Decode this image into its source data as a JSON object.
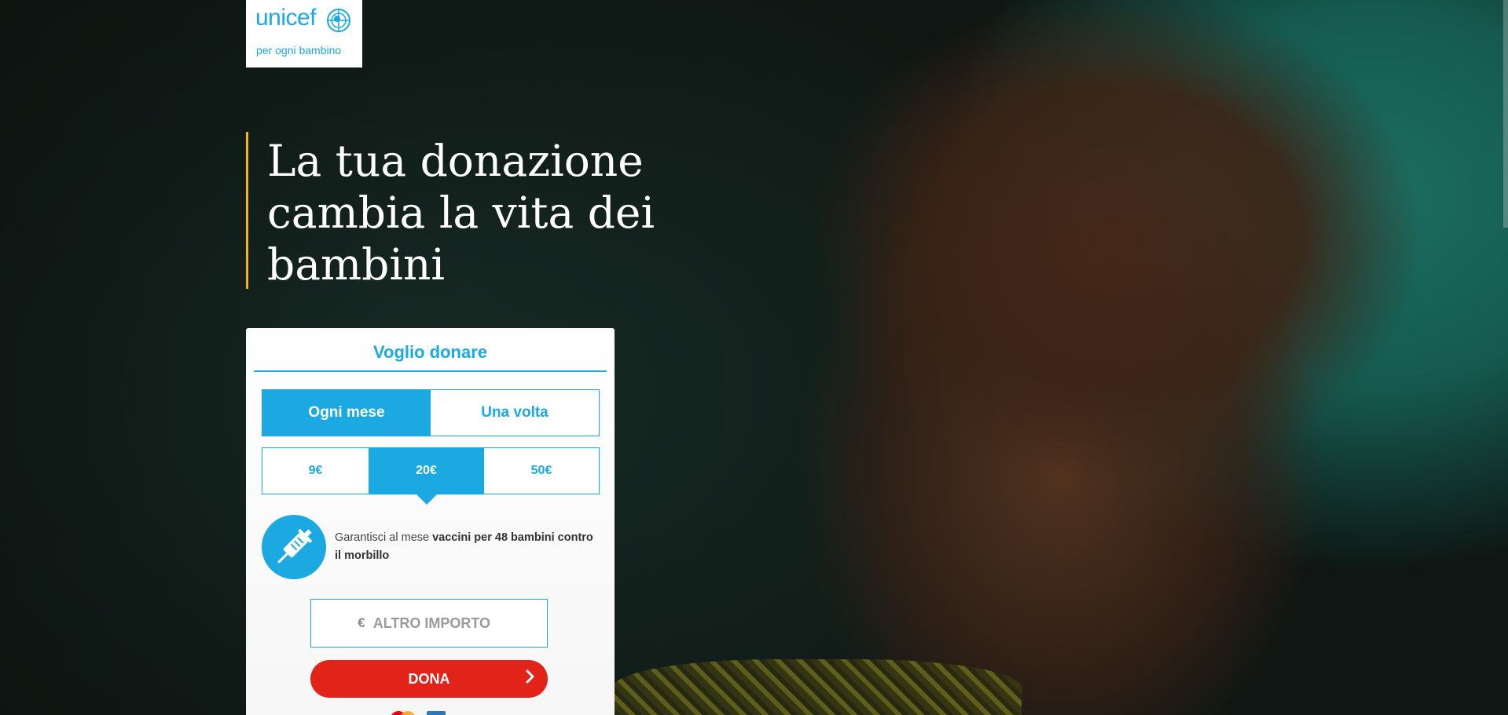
{
  "logo": {
    "wordmark": "unicef",
    "tagline": "per ogni bambino"
  },
  "hero": {
    "headline": "La tua donazione cambia la vita dei bambini"
  },
  "donation": {
    "title": "Voglio donare",
    "frequency": {
      "options": [
        "Ogni mese",
        "Una volta"
      ],
      "selected": "Ogni mese"
    },
    "amounts": {
      "options": [
        "9€",
        "20€",
        "50€"
      ],
      "selected": "20€"
    },
    "impact": {
      "prefix": "Garantisci al mese ",
      "highlight": "vaccini per 48 bambini contro il morbillo",
      "icon": "syringe-icon"
    },
    "other_amount": {
      "currency": "€",
      "placeholder": "ALTRO IMPORTO",
      "value": ""
    },
    "submit_label": "DONA"
  },
  "colors": {
    "brand_blue": "#1ca9e1",
    "donate_red": "#e2231a",
    "accent_yellow": "#f3b51a"
  }
}
